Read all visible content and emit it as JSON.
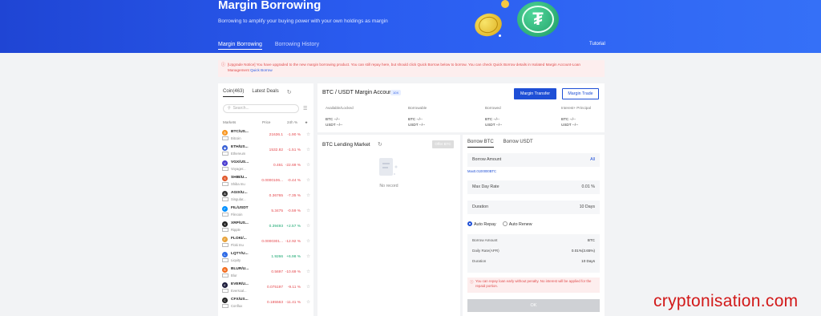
{
  "banner": {
    "title": "Margin Borrowing",
    "subtitle": "Borrowing to amplify your buying power with your own holdings as margin",
    "tabs": [
      {
        "label": "Margin Borrowing"
      },
      {
        "label": "Borrowing History"
      }
    ],
    "tutorial": "Tutorial",
    "bg_color": "#2a5cf0"
  },
  "notice": {
    "icon": "alert-icon",
    "text": "[Upgrade Notice] You have upgraded to the new margin borrowing product. You can still repay here, but should click Quick Borrow below to borrow. You can check Quick Borrow details in Isolated Margin Account-Loan Management",
    "link": "Quick Borrow"
  },
  "coins_panel": {
    "tab_coin": "Coin(463)",
    "tab_latest": "Latest Deals",
    "search_placeholder": "Search...",
    "headers": {
      "markets": "Markets",
      "price": "Price",
      "change": "24h %"
    },
    "rows": [
      {
        "pair": "BTC/US...",
        "name": "Bitcoin",
        "price": "21636.1",
        "change": "-1.90 %",
        "color": "#f7931a",
        "glyph": "₿",
        "up": false
      },
      {
        "pair": "ETH/US...",
        "name": "Ethereum",
        "price": "1532.82",
        "change": "-1.51 %",
        "color": "#3c63d6",
        "glyph": "◆",
        "up": false
      },
      {
        "pair": "VGX/US...",
        "name": "Voyager...",
        "price": "0.461",
        "change": "-22.69 %",
        "color": "#4a3ccf",
        "glyph": "V",
        "up": false
      },
      {
        "pair": "SHIB/U...",
        "name": "Shiba Inu",
        "price": "0.0000106...",
        "change": "-0.44 %",
        "color": "#e0572a",
        "glyph": "S",
        "up": false
      },
      {
        "pair": "AGIX/U...",
        "name": "Singular...",
        "price": "0.36765",
        "change": "-7.35 %",
        "color": "#333333",
        "glyph": "A",
        "up": false
      },
      {
        "pair": "FIL/USDT",
        "name": "Filecoin",
        "price": "5.3475",
        "change": "-0.59 %",
        "color": "#0090ff",
        "glyph": "F",
        "up": false
      },
      {
        "pair": "XRP/US...",
        "name": "Ripple",
        "price": "0.39493",
        "change": "+2.57 %",
        "color": "#222222",
        "glyph": "X",
        "up": true
      },
      {
        "pair": "FLOKI/...",
        "name": "Floki Inu",
        "price": "0.0000301...",
        "change": "-12.92 %",
        "color": "#e8a33a",
        "glyph": "F",
        "up": false
      },
      {
        "pair": "LQTY/U...",
        "name": "Liquity",
        "price": "1.9266",
        "change": "+6.98 %",
        "color": "#2e6be6",
        "glyph": "L",
        "up": true
      },
      {
        "pair": "BLUR/U...",
        "name": "Blur",
        "price": "0.5697",
        "change": "-10.69 %",
        "color": "#f26b1d",
        "glyph": "B",
        "up": false
      },
      {
        "pair": "EVER/U...",
        "name": "Everscal...",
        "price": "0.075197",
        "change": "-9.11 %",
        "color": "#1b1b3a",
        "glyph": "E",
        "up": false
      },
      {
        "pair": "CFX/US...",
        "name": "Conflux",
        "price": "0.185563",
        "change": "-11.41 %",
        "color": "#222222",
        "glyph": "C",
        "up": false
      }
    ]
  },
  "account": {
    "title": "BTC / USDT Margin Account",
    "badge": "10X",
    "transfer_btn": "Margin Transfer",
    "trade_btn": "Margin Trade",
    "columns": [
      {
        "label": "Available/Locked",
        "l1": "BTC        --/--",
        "l2": "USDT      --/--"
      },
      {
        "label": "Borrowable",
        "l1": "BTC        --/--",
        "l2": "USDT      --/--"
      },
      {
        "label": "Borrowed",
        "l1": "BTC        --/--",
        "l2": "USDT      --/--"
      },
      {
        "label": "Interest+ Principal",
        "l1": "BTC        --/--",
        "l2": "USDT      --/--"
      }
    ]
  },
  "lending": {
    "title": "BTC Lending Market",
    "offer_btn": "Offer BTC",
    "empty_text": "No record"
  },
  "borrow": {
    "tab_btc": "Borrow BTC",
    "tab_usdt": "Borrow USDT",
    "amount_label": "Borrow Amount",
    "all_label": "All",
    "max_text": "Max0.0100000BTC",
    "rate_label": "Max Day Rate",
    "rate_value": "0.01 %",
    "duration_label": "Duration",
    "duration_value": "10 Days",
    "auto_repay": "Auto Repay",
    "auto_renew": "Auto Renew",
    "summary": [
      {
        "label": "Borrow Amount",
        "value": "BTC"
      },
      {
        "label": "Daily Rate(APR)",
        "value": "0.01%(3.65%)"
      },
      {
        "label": "Duration",
        "value": "10 Days"
      }
    ],
    "warning": "You can repay loan early without penalty. No interest will be applied for the repaid portion.",
    "ok_btn": "OK"
  },
  "watermark": "cryptonisation.com"
}
